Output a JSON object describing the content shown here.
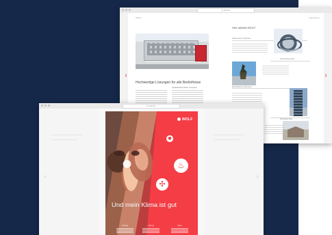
{
  "scene": {
    "background_color": "#16284a",
    "accent_red": "#f53d45",
    "browser_gray": "#f3f3f3"
  },
  "back_window": {
    "url": "lp.wolf.de",
    "left_page": {
      "top_left_text": "WOLF",
      "top_right_text": "Innovation",
      "headline": "Hochwertige Lösungen für alle Bedürfnisse",
      "subhead_a": "Verlässlichkeit fühlen und finden",
      "subhead_b": "Von der Planung bis zur Wartung"
    },
    "right_page": {
      "top_right_text": "Referenzen",
      "title": "Hier arbeitet WOLF",
      "labels": [
        "Allianz Arena, München",
        "Konzerthaus Wien",
        "Maximilianeum München",
        "Wohnhaus Elbe"
      ]
    },
    "icons": [
      "chevron-left-icon",
      "chevron-right-icon"
    ]
  },
  "front_window": {
    "url": "lp.wolf.de",
    "logo_text": "WOLF",
    "slogan": "Und mein Klima ist gut",
    "column_titles": [
      "Heizung",
      "Lüftung",
      "Klima"
    ],
    "icons": [
      "chevron-left-icon",
      "chevron-right-icon",
      "droplet-icon",
      "flame-icon",
      "fan-icon"
    ]
  }
}
